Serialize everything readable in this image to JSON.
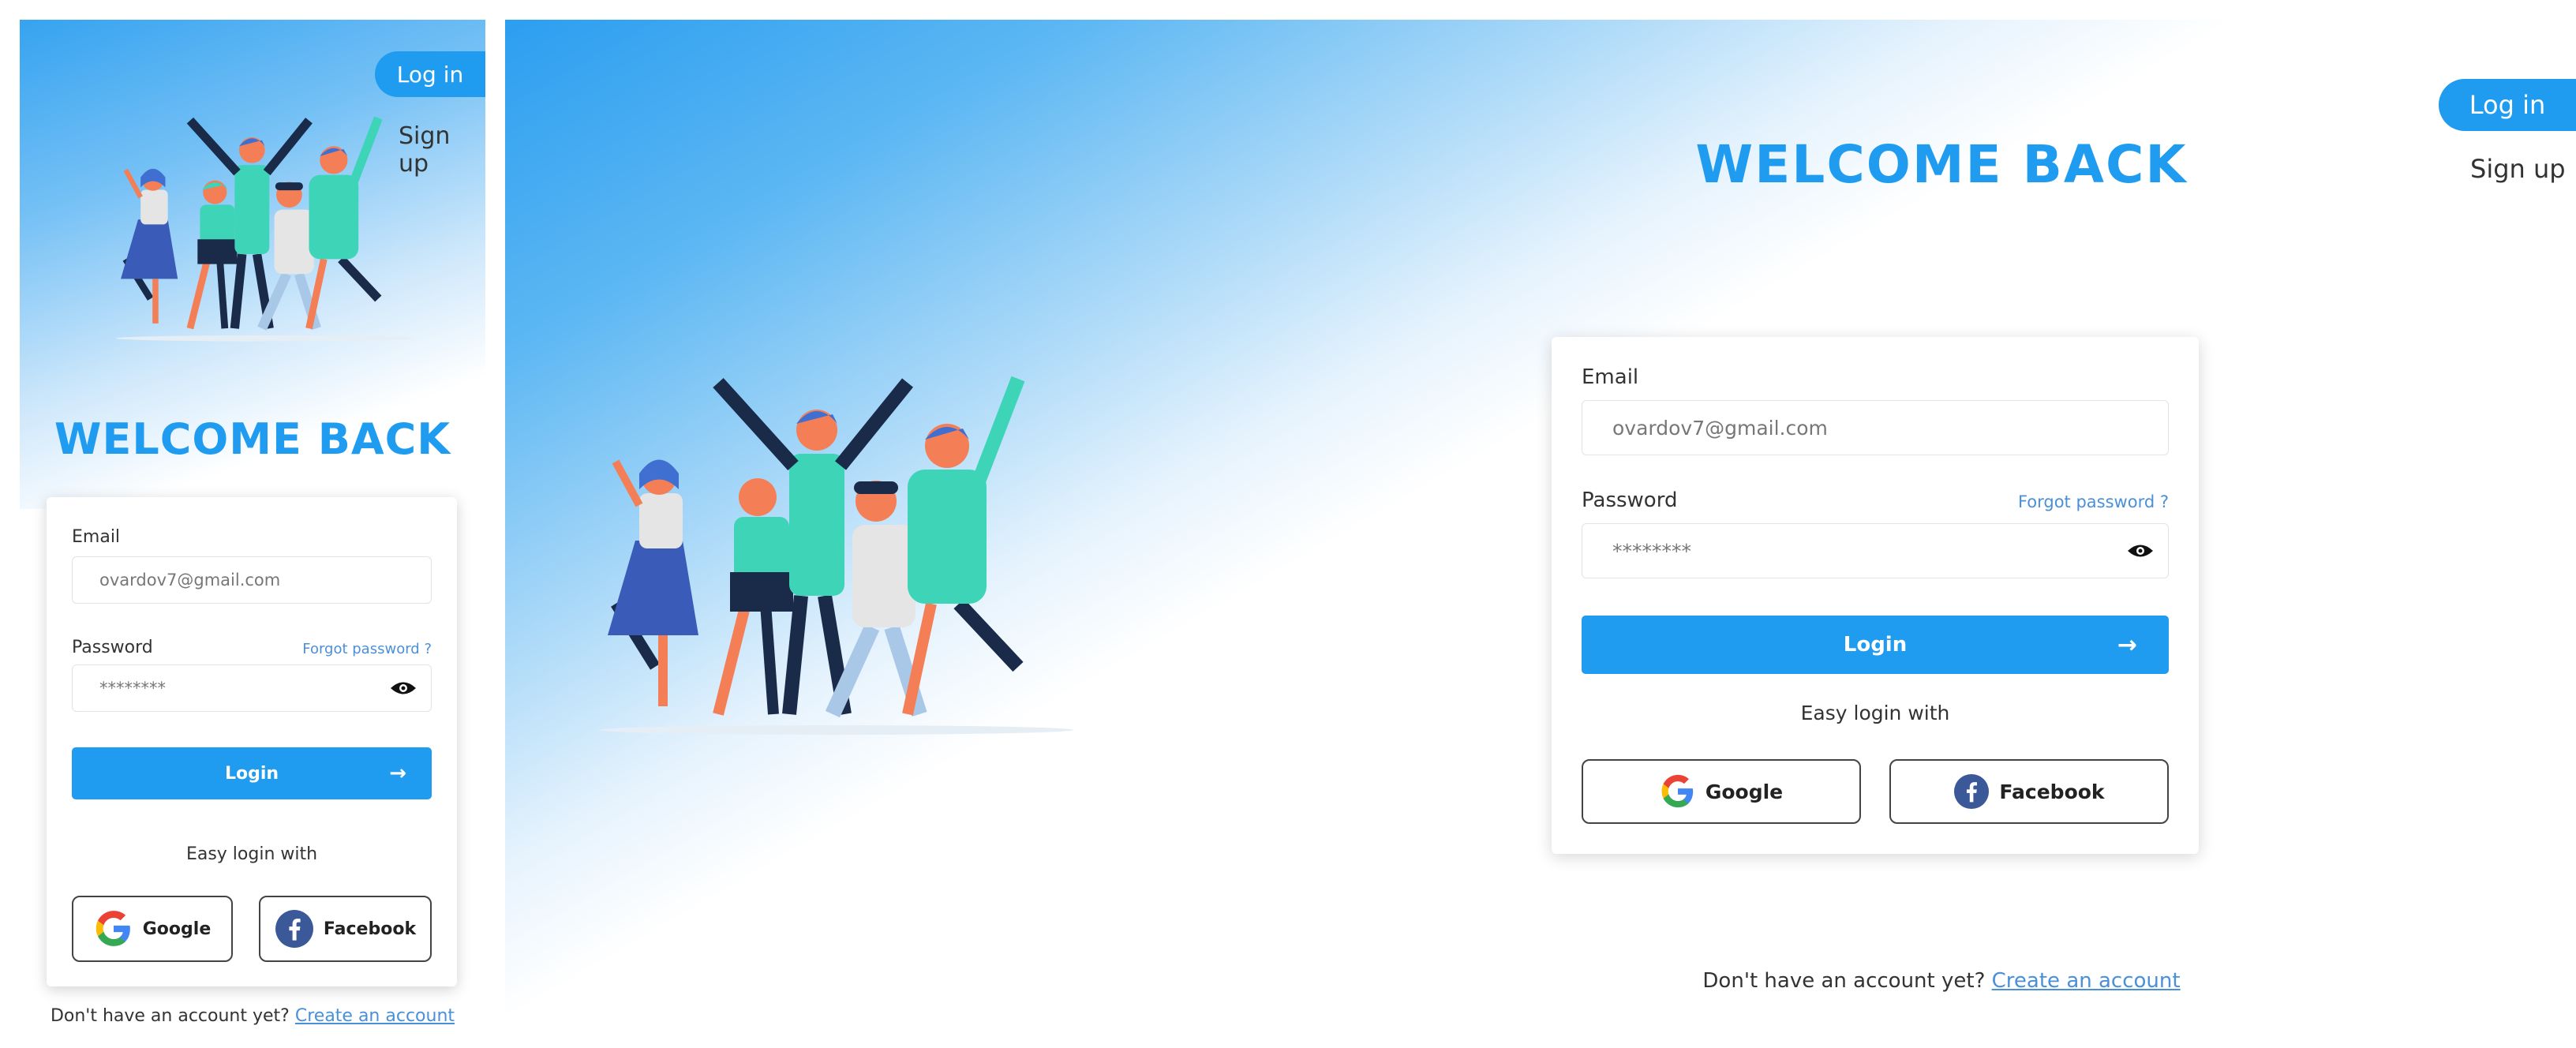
{
  "header": {
    "login_label": "Log in",
    "signup_label": "Sign up"
  },
  "title": "WELCOME BACK",
  "form": {
    "email_label": "Email",
    "email_value": "ovardov7@gmail.com",
    "password_label": "Password",
    "password_value": "********",
    "forgot_label": "Forgot password ?",
    "login_button": "Login",
    "login_arrow": "→",
    "easy_login": "Easy login with",
    "google_label": "Google",
    "facebook_label": "Facebook"
  },
  "footer": {
    "text": "Don't have an account yet?",
    "link": "Create an account"
  },
  "icons": {
    "eye": "eye-icon",
    "google": "google-icon",
    "facebook": "facebook-icon",
    "arrow": "arrow-right-icon"
  },
  "colors": {
    "accent": "#1f9cf0",
    "link": "#4a90d9",
    "facebook": "#3b5998"
  }
}
